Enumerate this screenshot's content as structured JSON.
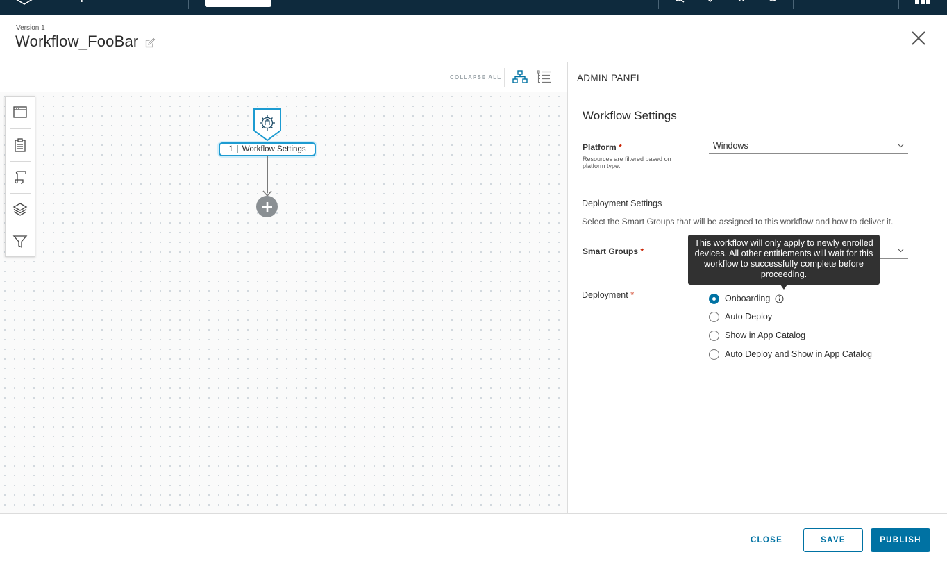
{
  "header": {
    "version": "Version 1",
    "title": "Workflow_FooBar"
  },
  "canvas": {
    "collapse_all": "COLLAPSE ALL",
    "rail_icons": [
      "browser-icon",
      "clipboard-icon",
      "script-icon",
      "layers-icon",
      "filter-icon"
    ],
    "node": {
      "number": "1",
      "label": "Workflow Settings"
    }
  },
  "panel": {
    "title": "ADMIN PANEL",
    "section_title": "Workflow Settings",
    "platform": {
      "label": "Platform",
      "required": "*",
      "help": "Resources are filtered based on platform type.",
      "value": "Windows"
    },
    "deployment_settings": {
      "title": "Deployment Settings",
      "description": "Select the Smart Groups that will be assigned to this workflow and how to deliver it."
    },
    "smart_groups": {
      "label": "Smart Groups",
      "required": "*",
      "value": ""
    },
    "deployment": {
      "label": "Deployment",
      "required": "*",
      "options": [
        {
          "label": "Onboarding",
          "selected": true
        },
        {
          "label": "Auto Deploy",
          "selected": false
        },
        {
          "label": "Show in App Catalog",
          "selected": false
        },
        {
          "label": "Auto Deploy and Show in App Catalog",
          "selected": false
        }
      ]
    },
    "tooltip": "This workflow will only apply to newly enrolled devices. All other entitlements will wait for this workflow to successfully complete before proceeding."
  },
  "footer": {
    "close_label": "CLOSE",
    "save_label": "SAVE",
    "publish_label": "PUBLISH"
  },
  "colors": {
    "topbar": "#0e2a3d",
    "primary": "#0072a3",
    "node_accent": "#1d9bd1",
    "required": "#c92100"
  }
}
